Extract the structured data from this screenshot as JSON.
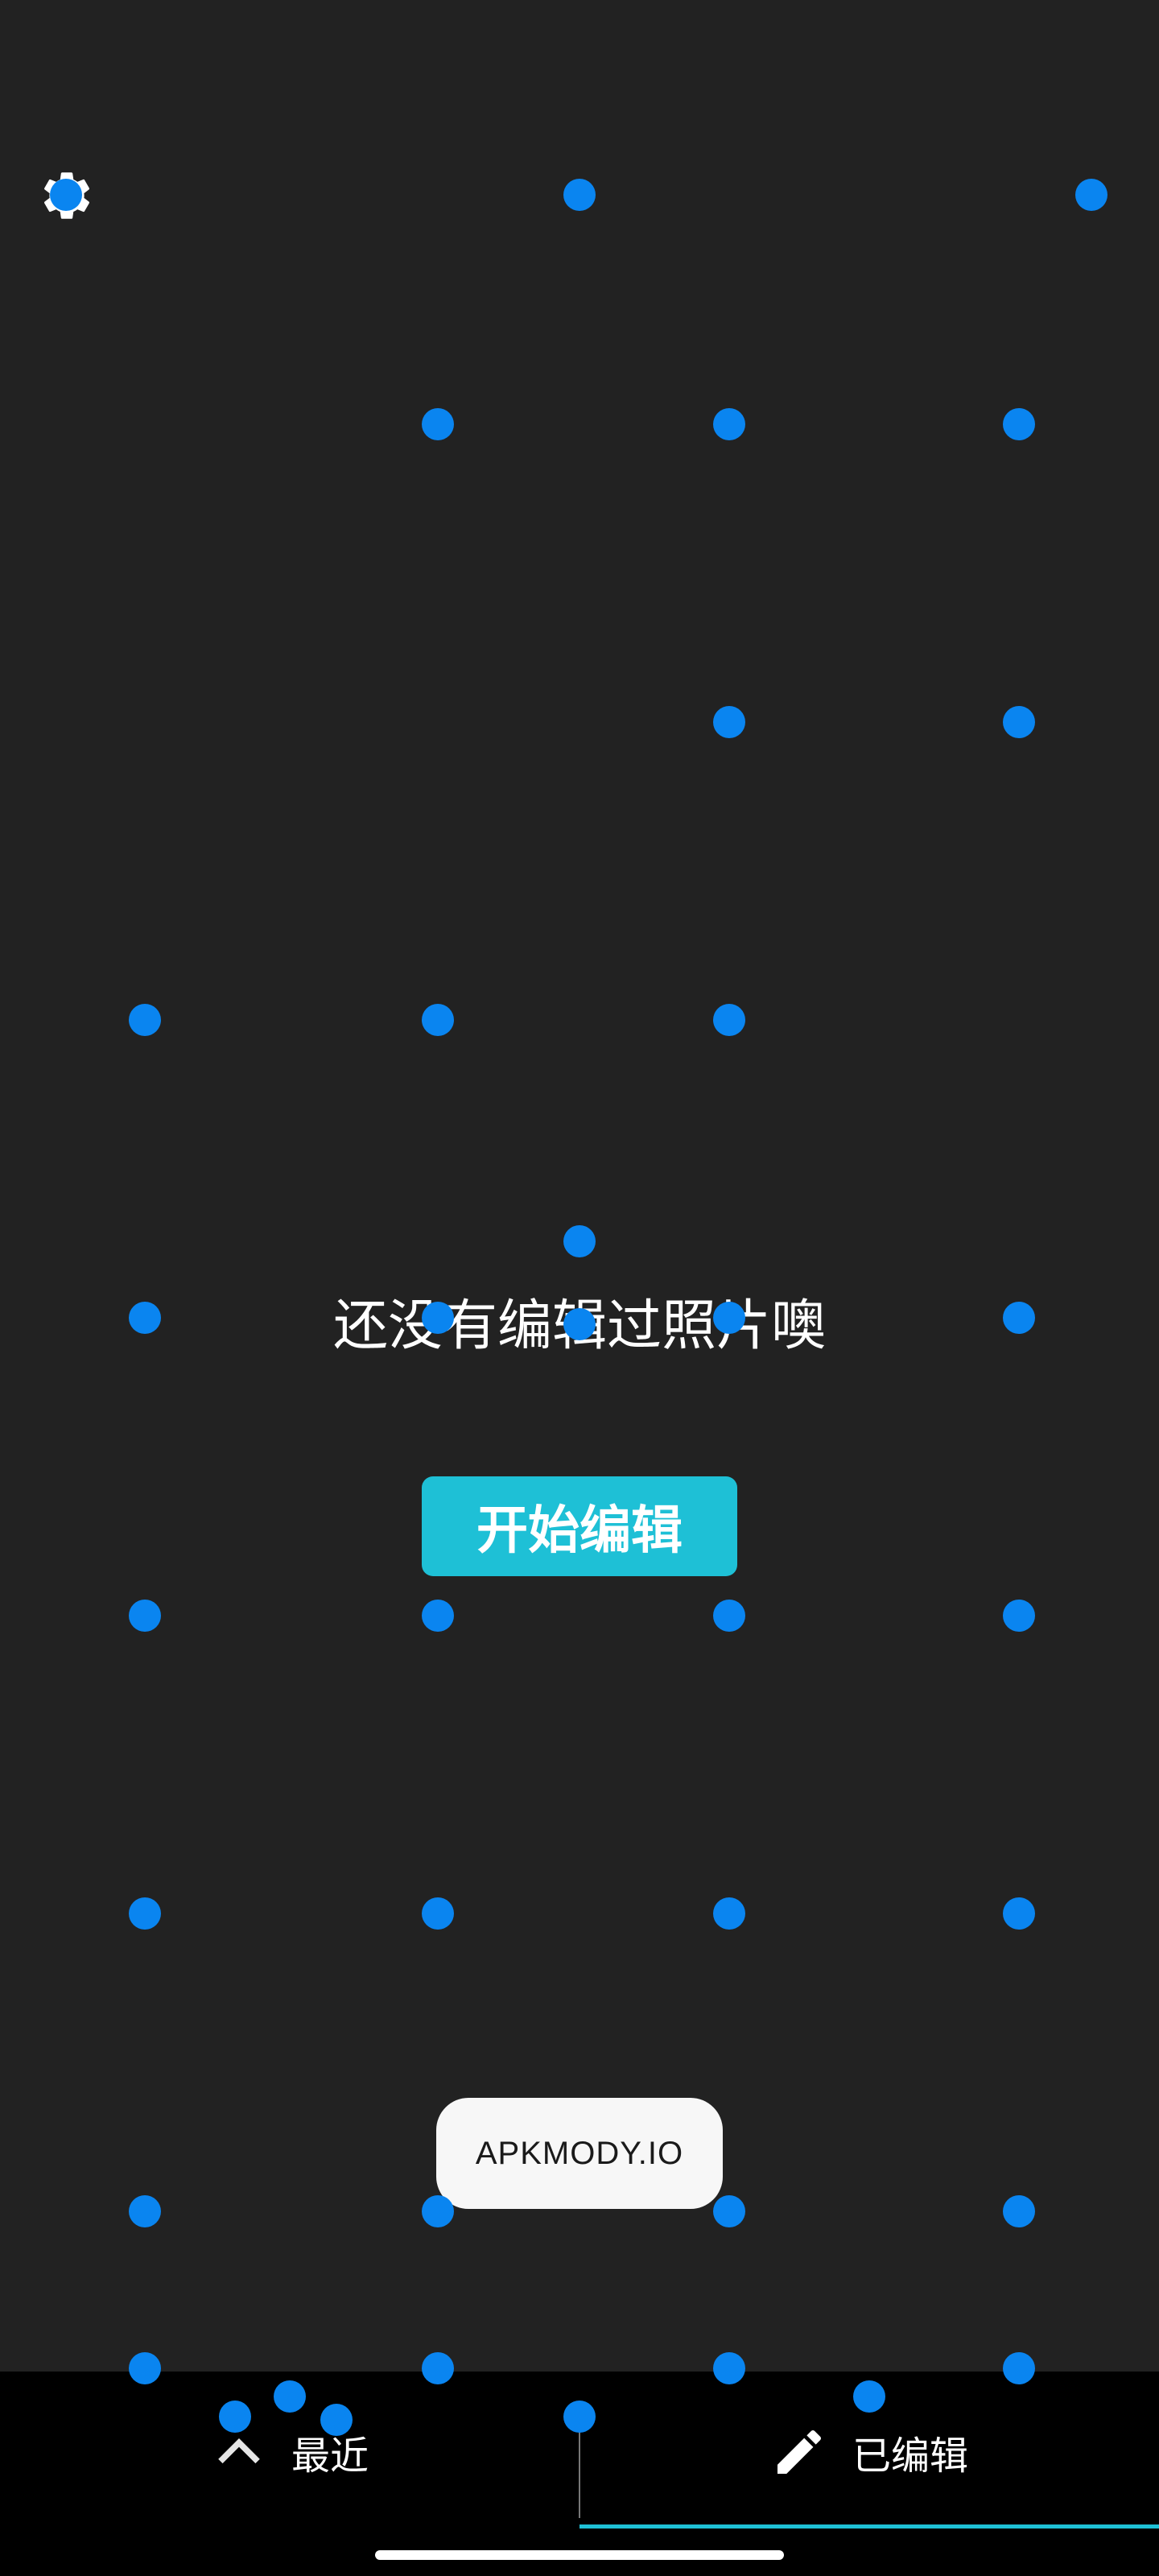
{
  "empty_state": {
    "message": "还没有编辑过照片噢",
    "start_button_label": "开始编辑"
  },
  "toast": {
    "text": "APKMODY.IO"
  },
  "bottom_nav": {
    "recent_label": "最近",
    "edited_label": "已编辑",
    "active_tab": "edited"
  },
  "icons": {
    "settings": "gear-icon",
    "recent": "chevron-up-icon",
    "edited": "pencil-icon"
  },
  "colors": {
    "background": "#222222",
    "accent": "#1ec0d6",
    "touch_dots": "#0a85f0",
    "nav_background": "#000000",
    "toast_background": "#f7f7f7"
  }
}
